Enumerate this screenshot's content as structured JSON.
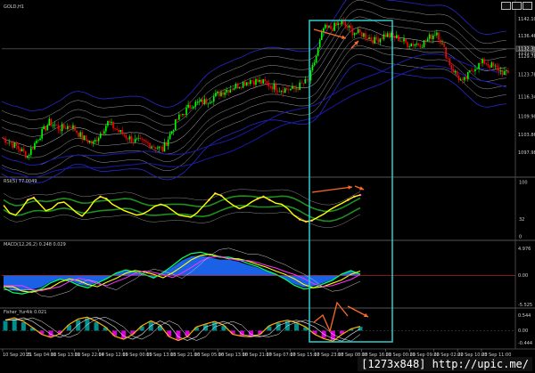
{
  "window": {
    "minimize_icon": "minimize-icon",
    "maximize_icon": "maximize-icon",
    "close_icon": "close-icon"
  },
  "panels": {
    "price": {
      "caption": "GOLD,H1"
    },
    "rsi": {
      "caption": "RSI(5) 77.0049"
    },
    "macd": {
      "caption": "MACD(12,26,2) 0.248 0.029"
    },
    "fisher": {
      "caption": "Fisher_Yur4ik 0.021"
    }
  },
  "watermark": "[1273x848] http://upic.me/",
  "colors": {
    "background": "#000000",
    "up_candle": "#00ff00",
    "down_candle": "#ff0000",
    "highlight_box": "#33cccc",
    "annotation_arrow": "#ff6a2a",
    "rsi_line": "#ffff00",
    "macd_histogram": "#1e6cff",
    "fisher_up_bar": "#00a6a6",
    "fisher_down_bar": "#ff00ff"
  },
  "chart_data": [
    {
      "type": "candlestick",
      "symbol": "GOLD",
      "timeframe": "H1",
      "ylim": [
        1090.5,
        1145.5
      ],
      "y_ticks": [
        "1142.10",
        "1136.46",
        "1131.00",
        "1129.78",
        "1123.78",
        "1116.34",
        "1109.90",
        "1103.86",
        "1097.98"
      ],
      "current_price": "1132.30",
      "x_ticks": [
        "10 Sep 2015",
        "11 Sep 04:00",
        "11 Sep 13:00",
        "11 Sep 22:00",
        "14 Sep 12:00",
        "15 Sep 00:00",
        "15 Sep 13:00",
        "15 Sep 21:00",
        "16 Sep 05:00",
        "16 Sep 13:00",
        "16 Sep 21:00",
        "17 Sep 07:00",
        "17 Sep 15:00",
        "17 Sep 23:00",
        "18 Sep 08:00",
        "18 Sep 16:00",
        "21 Sep 00:00",
        "21 Sep 09:00",
        "22 Sep 02:00",
        "22 Sep 10:00",
        "23 Sep 11:00"
      ],
      "close_path": [
        [
          0,
          1103
        ],
        [
          8,
          1100
        ],
        [
          14,
          1097
        ],
        [
          20,
          1103
        ],
        [
          26,
          1108
        ],
        [
          32,
          1106
        ],
        [
          38,
          1107
        ],
        [
          44,
          1103
        ],
        [
          50,
          1101
        ],
        [
          58,
          1108
        ],
        [
          64,
          1105
        ],
        [
          72,
          1102
        ],
        [
          80,
          1101
        ],
        [
          88,
          1099
        ],
        [
          96,
          1109
        ],
        [
          104,
          1114
        ],
        [
          112,
          1115
        ],
        [
          120,
          1118
        ],
        [
          128,
          1120
        ],
        [
          136,
          1122
        ],
        [
          144,
          1121
        ],
        [
          152,
          1119
        ],
        [
          160,
          1119
        ],
        [
          168,
          1122
        ],
        [
          172,
          1130
        ],
        [
          176,
          1139
        ],
        [
          180,
          1139
        ],
        [
          186,
          1141
        ],
        [
          192,
          1138
        ],
        [
          198,
          1137
        ],
        [
          204,
          1135
        ],
        [
          210,
          1137
        ],
        [
          216,
          1136
        ],
        [
          222,
          1134
        ],
        [
          230,
          1134
        ],
        [
          238,
          1138
        ],
        [
          246,
          1126
        ],
        [
          252,
          1121
        ],
        [
          258,
          1126
        ],
        [
          264,
          1128
        ],
        [
          270,
          1126
        ],
        [
          276,
          1124
        ]
      ]
    },
    {
      "type": "line",
      "indicator": "RSI(5)",
      "current": 77.0049,
      "ylim": [
        0,
        100
      ],
      "y_ticks": [
        "100",
        "32",
        "0"
      ],
      "series": [
        {
          "name": "RSI(5)",
          "color": "#ffff00",
          "values": [
            58,
            44,
            40,
            52,
            68,
            72,
            60,
            48,
            52,
            62,
            64,
            55,
            45,
            38,
            50,
            66,
            74,
            70,
            60,
            54,
            48,
            44,
            40,
            42,
            48,
            56,
            60,
            56,
            48,
            40,
            38,
            36,
            44,
            56,
            68,
            80,
            76,
            66,
            58,
            52,
            56,
            64,
            70,
            74,
            68,
            62,
            60,
            52,
            40,
            32,
            28,
            30,
            36,
            42,
            50,
            56,
            62,
            68,
            74,
            77
          ]
        }
      ]
    },
    {
      "type": "area",
      "indicator": "MACD(12,26,2)",
      "values_text": [
        "0.248",
        "0.029"
      ],
      "ylim": [
        -5.6,
        5.6
      ],
      "y_ticks": [
        "4.976",
        "0.00",
        "-5.525"
      ],
      "series": [
        {
          "name": "MACD",
          "color": "#1e6cff",
          "values": [
            -2.0,
            -2.8,
            -3.0,
            -2.6,
            -2.2,
            -1.2,
            -0.6,
            -0.9,
            -1.6,
            -2.0,
            -1.2,
            -0.5,
            0.4,
            0.9,
            0.6,
            0.2,
            -0.4,
            0.5,
            1.6,
            2.8,
            3.6,
            3.8,
            3.4,
            3.0,
            3.0,
            2.6,
            2.0,
            1.5,
            0.8,
            0.2,
            -0.6,
            -1.6,
            -2.2,
            -2.0,
            -1.4,
            -0.8,
            0.2,
            0.8,
            0.2
          ]
        }
      ]
    },
    {
      "type": "bar",
      "indicator": "Fisher_Yur4ik",
      "current": 0.021,
      "ylim": [
        -0.56,
        0.62
      ],
      "y_ticks": [
        "0.544",
        "0.00",
        "-0.444"
      ],
      "series": [
        {
          "name": "Fisher_Yur4ik",
          "color": "#00a6a6",
          "values": [
            0.35,
            0.42,
            0.3,
            0.1,
            -0.12,
            -0.22,
            -0.1,
            0.2,
            0.38,
            0.44,
            0.3,
            0.12,
            -0.18,
            -0.28,
            -0.12,
            0.16,
            0.32,
            0.18,
            -0.2,
            -0.32,
            -0.2,
            0.12,
            0.22,
            0.3,
            0.18,
            -0.12,
            -0.18,
            -0.2,
            -0.12,
            0.16,
            0.28,
            0.34,
            0.26,
            0.12,
            -0.12,
            -0.26,
            -0.34,
            -0.12,
            0.06,
            0.14
          ]
        }
      ]
    }
  ]
}
